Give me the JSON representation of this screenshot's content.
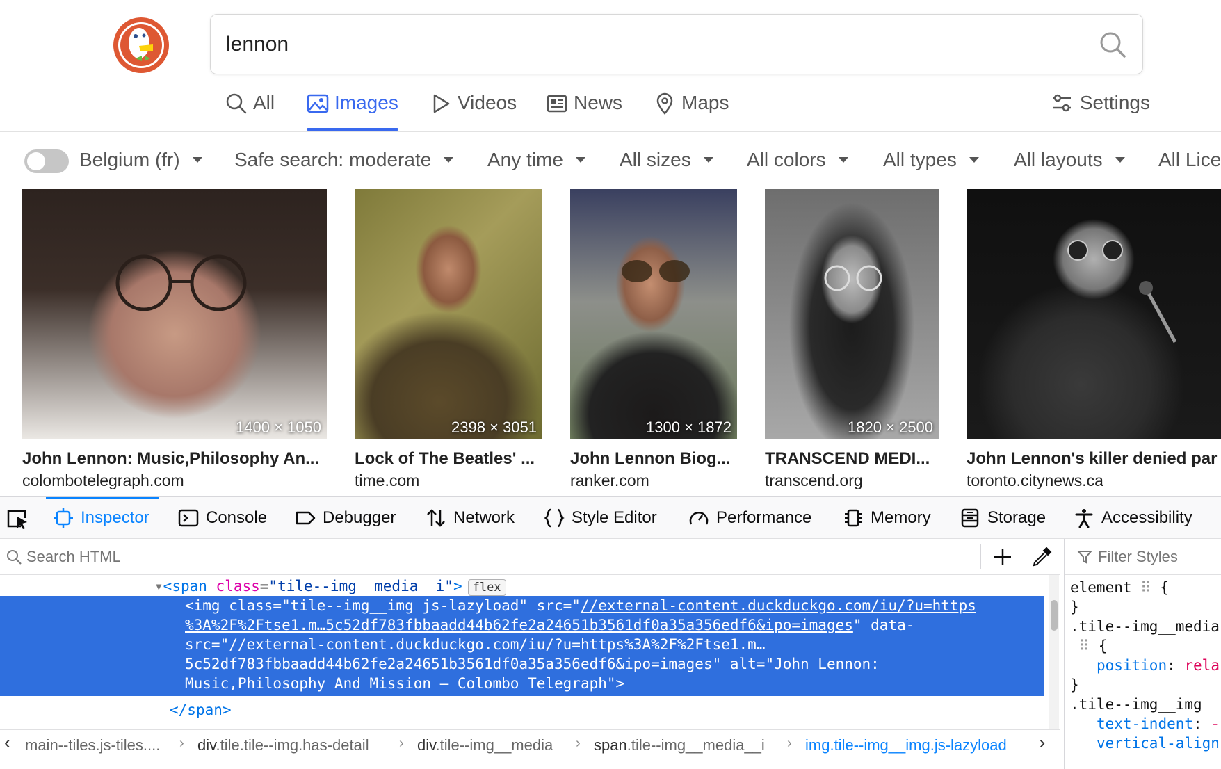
{
  "search": {
    "query": "lennon"
  },
  "tabs": [
    {
      "label": "All",
      "icon": "search-icon",
      "active": false
    },
    {
      "label": "Images",
      "icon": "image-icon",
      "active": true
    },
    {
      "label": "Videos",
      "icon": "play-icon",
      "active": false
    },
    {
      "label": "News",
      "icon": "newspaper-icon",
      "active": false
    },
    {
      "label": "Maps",
      "icon": "map-pin-icon",
      "active": false
    }
  ],
  "settings_label": "Settings",
  "filters": {
    "region": "Belgium (fr)",
    "safe_search": "Safe search: moderate",
    "time": "Any time",
    "size": "All sizes",
    "color": "All colors",
    "type": "All types",
    "layout": "All layouts",
    "license": "All Lice"
  },
  "results": [
    {
      "dimensions": "1400 × 1050",
      "title": "John Lennon: Music,Philosophy An...",
      "source": "colombotelegraph.com"
    },
    {
      "dimensions": "2398 × 3051",
      "title": "Lock of The Beatles' ...",
      "source": "time.com"
    },
    {
      "dimensions": "1300 × 1872",
      "title": "John Lennon Biog...",
      "source": "ranker.com"
    },
    {
      "dimensions": "1820 × 2500",
      "title": "TRANSCEND MEDI...",
      "source": "transcend.org"
    },
    {
      "dimensions": "",
      "title": "John Lennon's killer denied par",
      "source": "toronto.citynews.ca"
    }
  ],
  "devtools": {
    "tabs": [
      "Inspector",
      "Console",
      "Debugger",
      "Network",
      "Style Editor",
      "Performance",
      "Memory",
      "Storage",
      "Accessibility"
    ],
    "search_placeholder": "Search HTML",
    "filter_styles_placeholder": "Filter Styles",
    "markup": {
      "span_open_tag": "span",
      "span_class_attr": "class",
      "span_class_value": "\"tile--img__media__i\"",
      "flex_badge": "flex",
      "img_line1_pre": "<img class=\"tile--img__img js-lazyload\" src=\"",
      "img_line1_link": "//external-content.duckduckgo.com/iu/?u=https",
      "img_line2_link": "%3A%2F%2Ftse1.m…5c52df783fbbaadd44b62fe2a24651b3561df0a35a356edf6&ipo=images",
      "img_line2_post": "\" data-",
      "img_line3": "src=\"//external-content.duckduckgo.com/iu/?u=https%3A%2F%2Ftse1.m…",
      "img_line4": "5c52df783fbbaadd44b62fe2a24651b3561df0a35a356edf6&ipo=images\" alt=\"John Lennon:",
      "img_line5": "Music,Philosophy And Mission – Colombo Telegraph\">",
      "span_close": "span"
    },
    "rules": {
      "r1_selector": "element",
      "r2_selector": ".tile--img__media",
      "r2_prop": "position",
      "r2_value": "rela",
      "r3_selector": ".tile--img__img",
      "r3_prop": "text-indent",
      "r3_value": "-",
      "r3_next": "vertical-align"
    },
    "breadcrumbs": [
      {
        "tag": "",
        "cls": "main--tiles.js-tiles...."
      },
      {
        "tag": "div",
        "cls": ".tile.tile--img.has-detail"
      },
      {
        "tag": "div",
        "cls": ".tile--img__media"
      },
      {
        "tag": "span",
        "cls": ".tile--img__media__i"
      },
      {
        "tag": "img",
        "cls": ".tile--img__img.js-lazyload"
      }
    ]
  },
  "colors": {
    "accent": "#3969ef",
    "devtools_accent": "#0a84ff",
    "selection": "#2f6fde"
  }
}
